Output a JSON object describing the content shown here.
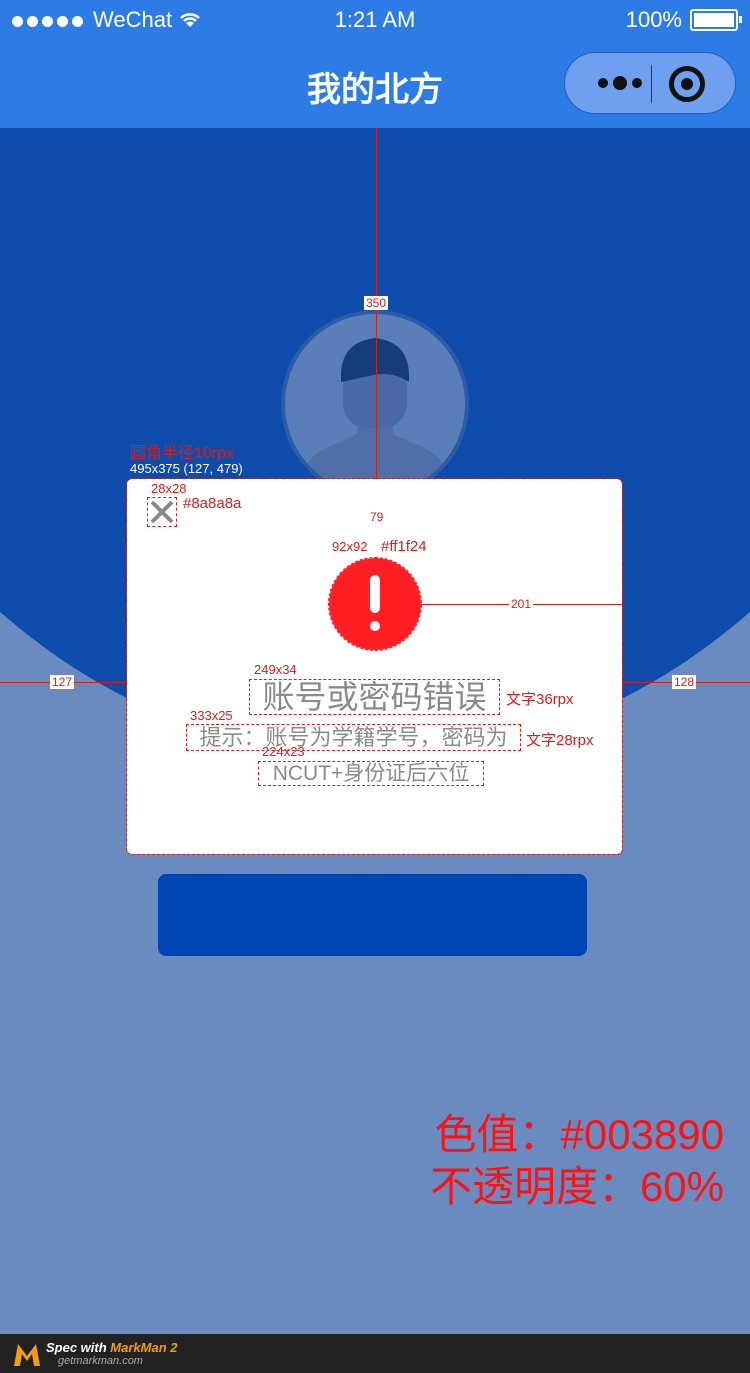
{
  "status_bar": {
    "carrier": "WeChat",
    "time": "1:21 AM",
    "battery": "100%"
  },
  "nav": {
    "title": "我的北方"
  },
  "dialog": {
    "title": "账号或密码错误",
    "hint_line1": "提示：账号为学籍学号，密码为",
    "hint_line2": "NCUT+身份证后六位"
  },
  "annotations": {
    "radius_note": "圆角半径10rpx",
    "dialog_size": "495x375 (127, 479)",
    "close_size": "28x28",
    "close_color": "#8a8a8a",
    "alert_size": "92x92",
    "alert_color": "#ff1f24",
    "title_size": "249x34",
    "title_font": "文字36rpx",
    "hint_size": "333x25",
    "hint_font": "文字28rpx",
    "hint2_size": "224x23",
    "dist_top": "350",
    "dist_gap": "79",
    "dist_right_icon": "201",
    "dist_left": "127",
    "dist_right": "128",
    "color_value": "色值：#003890",
    "opacity_value": "不透明度：60%"
  },
  "footer": {
    "spec_prefix": "Spec with ",
    "spec_brand": "MarkMan 2",
    "site": "getmarkman.com"
  },
  "colors": {
    "nav_bg": "#2d7be4",
    "overlay": "#003890",
    "alert": "#ff1f24",
    "close": "#8a8a8a",
    "button": "#0045b6"
  }
}
